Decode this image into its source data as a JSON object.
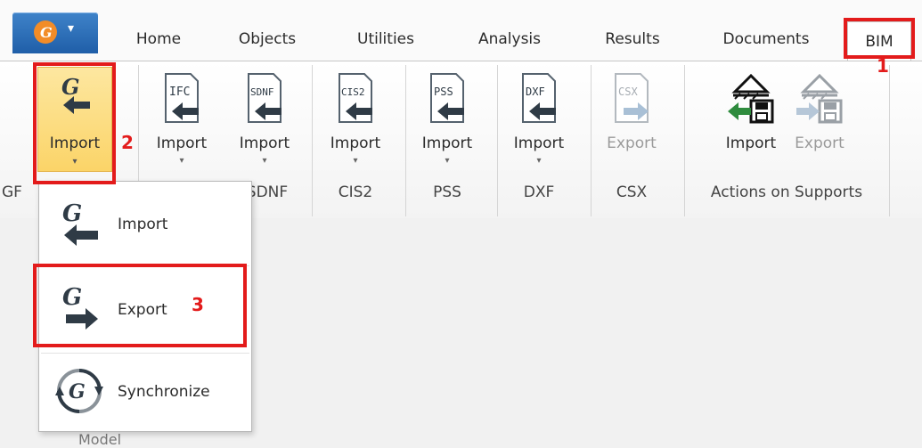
{
  "app_button": {
    "icon": "gravitech-logo-icon",
    "caret": "▾"
  },
  "tabs": [
    {
      "label": "Home"
    },
    {
      "label": "Objects"
    },
    {
      "label": "Utilities"
    },
    {
      "label": "Analysis"
    },
    {
      "label": "Results"
    },
    {
      "label": "Documents"
    },
    {
      "label": "BIM"
    }
  ],
  "ribbon": {
    "groups": [
      {
        "label": "GF",
        "buttons": [
          {
            "label": "Import",
            "icon": "g-import-icon",
            "caret": "▾"
          }
        ]
      },
      {
        "label": "SDNF",
        "buttons": [
          {
            "label": "Import",
            "icon": "ifc-import-icon",
            "caret": "▾"
          },
          {
            "label": "Import",
            "icon": "sdnf-import-icon",
            "caret": "▾"
          }
        ]
      },
      {
        "label": "CIS2",
        "buttons": [
          {
            "label": "Import",
            "icon": "cis2-import-icon",
            "caret": "▾"
          }
        ]
      },
      {
        "label": "PSS",
        "buttons": [
          {
            "label": "Import",
            "icon": "pss-import-icon",
            "caret": "▾"
          }
        ]
      },
      {
        "label": "DXF",
        "buttons": [
          {
            "label": "Import",
            "icon": "dxf-import-icon",
            "caret": "▾"
          }
        ]
      },
      {
        "label": "CSX",
        "buttons": [
          {
            "label": "Export",
            "icon": "csx-export-icon"
          }
        ]
      },
      {
        "label": "Actions on Supports",
        "buttons": [
          {
            "label": "Import",
            "icon": "supports-import-icon"
          },
          {
            "label": "Export",
            "icon": "supports-export-icon"
          }
        ]
      }
    ],
    "file_tags": {
      "ifc": "IFC",
      "sdnf": "SDNF",
      "cis2": "CIS2",
      "pss": "PSS",
      "dxf": "DXF",
      "csx": "CSX"
    }
  },
  "menu": {
    "items": [
      {
        "label": "Import",
        "icon": "g-import-icon"
      },
      {
        "label": "Export",
        "icon": "g-export-icon"
      },
      {
        "label": "Synchronize",
        "icon": "g-synchronize-icon"
      }
    ]
  },
  "annotations": [
    "1",
    "2",
    "3"
  ],
  "workspace": {
    "partial_label": "Model"
  },
  "colors": {
    "annotation": "#e31b1b",
    "active_button": "#fbd468",
    "app_button": "#1f5ea8"
  }
}
